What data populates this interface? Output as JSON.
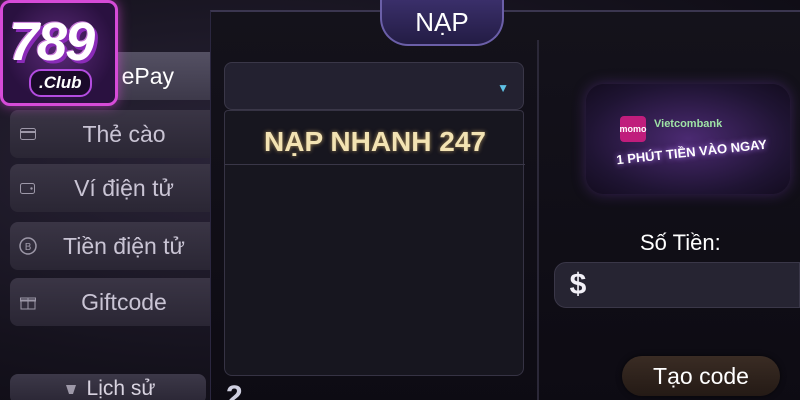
{
  "logo": {
    "number": "789",
    "club": ".Club"
  },
  "sidebar": {
    "items": [
      {
        "label": "ePay",
        "icon": "epay-icon",
        "active": true
      },
      {
        "label": "Thẻ cào",
        "icon": "card-icon"
      },
      {
        "label": "Ví điện tử",
        "icon": "wallet-icon"
      },
      {
        "label": "Tiền điện tử",
        "icon": "bitcoin-icon"
      },
      {
        "label": "Giftcode",
        "icon": "gift-icon"
      }
    ],
    "history_label": "Lịch sử"
  },
  "header": {
    "tab_label": "NẠP"
  },
  "method_select": {
    "caret": "▼"
  },
  "method_list": {
    "items": [
      "NẠP NHANH 247"
    ]
  },
  "partial_text": "2",
  "banner": {
    "momo": "momo",
    "bank": "Vietcombank",
    "text": "1 PHÚT TIỀN VÀO NGAY"
  },
  "amount": {
    "label": "Số Tiền:",
    "currency_symbol": "$"
  },
  "create_button": {
    "label": "Tạo code"
  },
  "colors": {
    "accent": "#d64bd8",
    "tab": "#3a2f6a",
    "highlight_text": "#f3e3b3"
  }
}
